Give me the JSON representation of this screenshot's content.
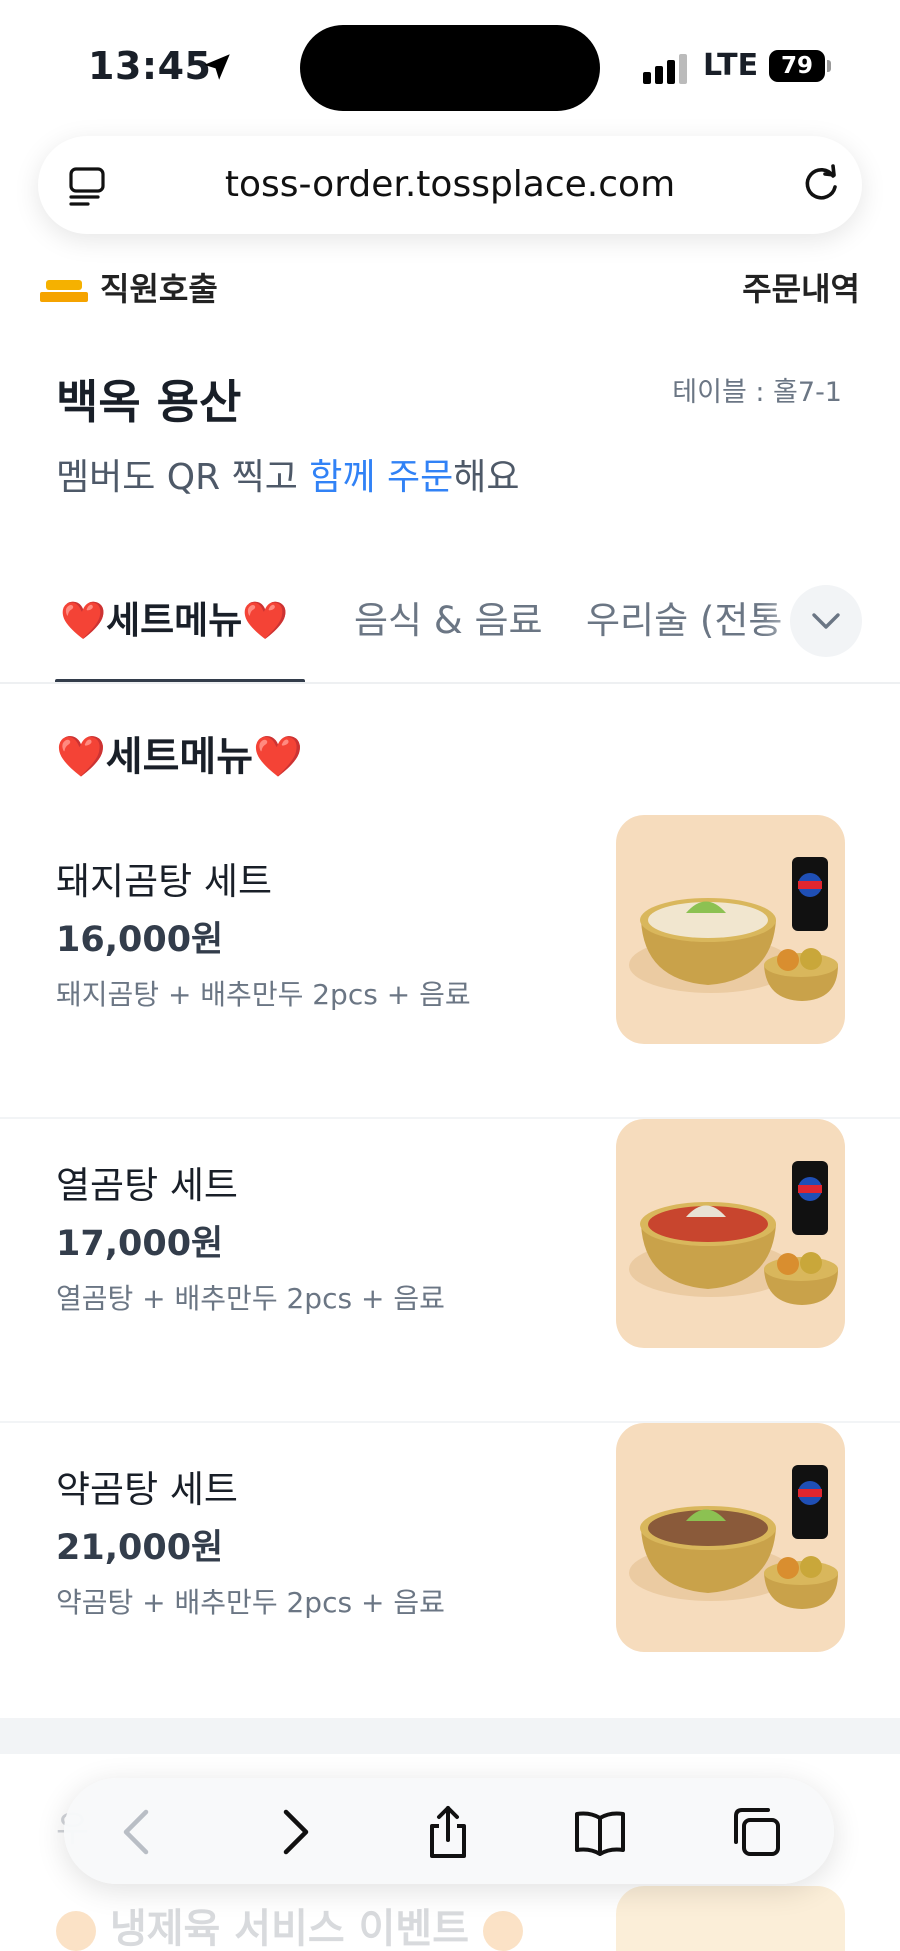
{
  "status_bar": {
    "time": "13:45",
    "network": "LTE",
    "battery": "79"
  },
  "browser": {
    "url": "toss-order.tossplace.com"
  },
  "header": {
    "staff_call": "직원호출",
    "order_history": "주문내역"
  },
  "store": {
    "name": "백옥 용산",
    "table": "테이블 : 홀7-1",
    "tagline_before": "멤버도 QR 찍고 ",
    "tagline_highlight": "함께 주문",
    "tagline_after": "해요"
  },
  "colors": {
    "accent": "#3182f6",
    "text_primary": "#191f28",
    "text_secondary": "#6b7684"
  },
  "category_tabs": [
    {
      "label": "❤️세트메뉴❤️",
      "active": true
    },
    {
      "label": "음식 & 음료",
      "active": false
    },
    {
      "label": "우리술 (전통",
      "active": false
    }
  ],
  "section": {
    "title": "❤️세트메뉴❤️"
  },
  "menu_items": [
    {
      "name": "돼지곰탕 세트",
      "price": "16,000원",
      "desc": "돼지곰탕 + 배추만두 2pcs + 음료",
      "soup": "#f1e6cf"
    },
    {
      "name": "열곰탕 세트",
      "price": "17,000원",
      "desc": "열곰탕 + 배추만두 2pcs + 음료",
      "soup": "#c8452e"
    },
    {
      "name": "약곰탕 세트",
      "price": "21,000원",
      "desc": "약곰탕 + 배추만두 2pcs + 음료",
      "soup": "#8a5a3a"
    }
  ],
  "next_section": {
    "partial_char": "우",
    "title": "냉제육 서비스 이벤트"
  },
  "toolbar": {
    "icons": [
      "back-icon",
      "forward-icon",
      "share-icon",
      "bookmarks-icon",
      "tabs-icon"
    ]
  }
}
